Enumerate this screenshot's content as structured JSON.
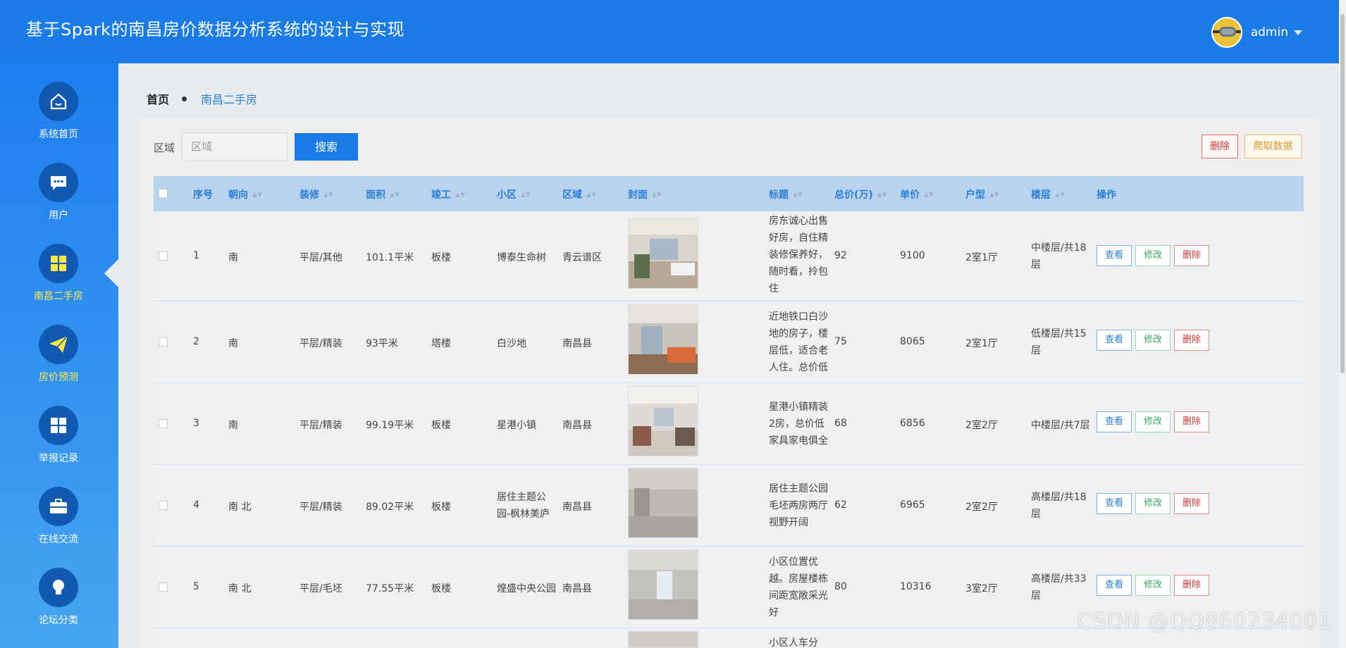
{
  "header": {
    "title": "基于Spark的南昌房价数据分析系统的设计与实现",
    "username": "admin"
  },
  "sidebar": {
    "items": [
      {
        "label": "系统首页",
        "icon": "home-icon"
      },
      {
        "label": "用户",
        "icon": "chat-icon"
      },
      {
        "label": "南昌二手房",
        "icon": "grid-icon"
      },
      {
        "label": "房价预测",
        "icon": "paper-plane-icon"
      },
      {
        "label": "举报记录",
        "icon": "grid-icon"
      },
      {
        "label": "在线交流",
        "icon": "briefcase-icon"
      },
      {
        "label": "论坛分类",
        "icon": "lightbulb-icon"
      }
    ]
  },
  "breadcrumb": {
    "home": "首页",
    "current": "南昌二手房"
  },
  "search": {
    "label": "区域",
    "placeholder": "区域",
    "button": "搜索"
  },
  "toolbar": {
    "delete": "删除",
    "crawl": "爬取数据"
  },
  "table": {
    "headers": {
      "index": "序号",
      "orientation": "朝向",
      "decoration": "装修",
      "area": "面积",
      "completion": "竣工",
      "community": "小区",
      "region": "区域",
      "cover": "封面",
      "title": "标题",
      "total_price": "总价(万)",
      "unit_price": "单价",
      "layout": "户型",
      "floor": "楼层",
      "actions": "操作"
    },
    "actions": {
      "view": "查看",
      "edit": "修改",
      "delete": "删除"
    },
    "rows": [
      {
        "index": "1",
        "orientation": "南",
        "decoration": "平层/其他",
        "area": "101.1平米",
        "completion": "板楼",
        "community": "博泰生命树",
        "region": "青云谱区",
        "title": "房东诚心出售好房，自住精装修保养好，随时看，拎包住",
        "total_price": "92",
        "unit_price": "9100",
        "layout": "2室1厅",
        "floor": "中楼层/共18层"
      },
      {
        "index": "2",
        "orientation": "南",
        "decoration": "平层/精装",
        "area": "93平米",
        "completion": "塔楼",
        "community": "白沙地",
        "region": "南昌县",
        "title": "近地铁口白沙地的房子，楼层低，适合老人住。总价低",
        "total_price": "75",
        "unit_price": "8065",
        "layout": "2室1厅",
        "floor": "低楼层/共15层"
      },
      {
        "index": "3",
        "orientation": "南",
        "decoration": "平层/精装",
        "area": "99.19平米",
        "completion": "板楼",
        "community": "星港小镇",
        "region": "南昌县",
        "title": "星港小镇精装2房，总价低家具家电俱全",
        "total_price": "68",
        "unit_price": "6856",
        "layout": "2室2厅",
        "floor": "中楼层/共7层"
      },
      {
        "index": "4",
        "orientation": "南 北",
        "decoration": "平层/精装",
        "area": "89.02平米",
        "completion": "板楼",
        "community": "居住主题公园-枫林美庐",
        "region": "南昌县",
        "title": "居住主题公园毛坯两房两厅视野开阔",
        "total_price": "62",
        "unit_price": "6965",
        "layout": "2室2厅",
        "floor": "高楼层/共18层"
      },
      {
        "index": "5",
        "orientation": "南 北",
        "decoration": "平层/毛坯",
        "area": "77.55平米",
        "completion": "板楼",
        "community": "煌盛中央公园",
        "region": "南昌县",
        "title": "小区位置优越。房屋楼栋间距宽敞采光好",
        "total_price": "80",
        "unit_price": "10316",
        "layout": "3室2厅",
        "floor": "高楼层/共33层"
      },
      {
        "title": "小区人车分"
      }
    ]
  },
  "watermark": "CSDN @QQ860234001",
  "colors": {
    "primary": "#1a7be6",
    "sidebar_top": "#1d7ef0",
    "active_label": "#ffe74a",
    "danger": "#d43b3b",
    "success": "#3aaa6a",
    "warning": "#e09a2a"
  }
}
